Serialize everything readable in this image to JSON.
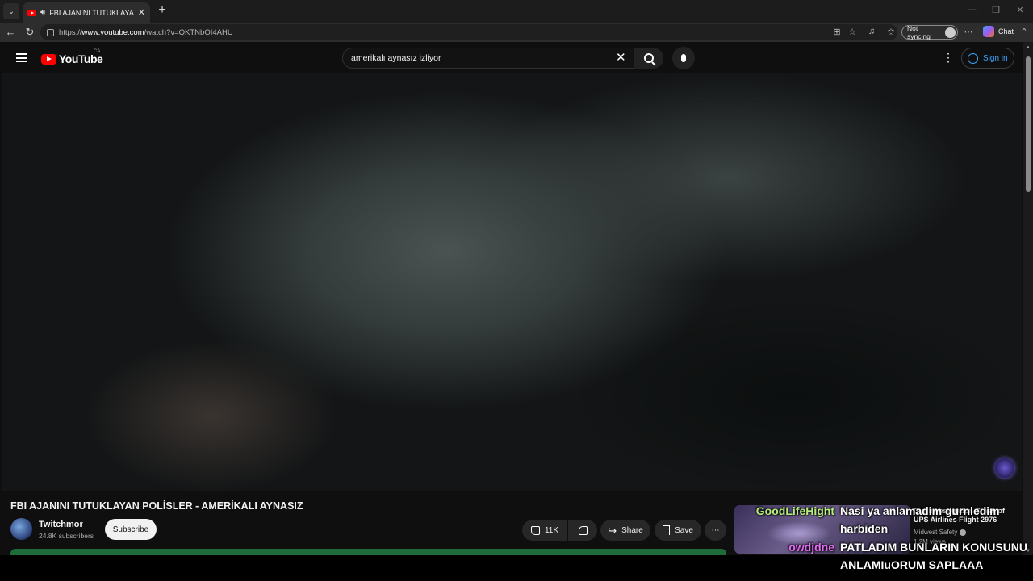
{
  "browser": {
    "tab_title": "FBI AJANINI TUTUKLAYAN POLİ",
    "url_prefix": "https://",
    "url_domain": "www.youtube.com",
    "url_path": "/watch?v=QKTNbOI4AHU",
    "sync_label": "Not syncing",
    "chat_label": "Chat"
  },
  "youtube": {
    "logo_text": "YouTube",
    "country_code": "CA",
    "search_query": "amerikalı aynasız izliyor",
    "sign_in_label": "Sign in"
  },
  "video": {
    "title": "FBI AJANINI TUTUKLAYAN POLİSLER - AMERİKALI AYNASIZ",
    "channel_name": "Twitchmor",
    "subscribers": "24.8K subscribers",
    "subscribe_label": "Subscribe",
    "likes": "11K",
    "share_label": "Share",
    "save_label": "Save"
  },
  "recommendation": {
    "title": "Our Investigation Crash of UPS Airlines Flight 2976",
    "channel": "Midwest Safety",
    "meta": "1.2M views"
  },
  "chat_overlay": [
    {
      "user": "GoodLifeHight",
      "user_color": "#b6f07a",
      "message_lines": [
        "Nasi ya anlamadim gurnledim",
        "harbiden"
      ]
    },
    {
      "user": "owdjdne",
      "user_color": "#e06cf0",
      "message_lines": [
        "PATLADIM BUNLARIN KONUSUNU",
        "ANLAMIuORUM SAPLAAA"
      ]
    }
  ],
  "colors": {
    "accent_red": "#ff0000",
    "link_blue": "#3ea6ff",
    "background": "#0f0f0f"
  }
}
